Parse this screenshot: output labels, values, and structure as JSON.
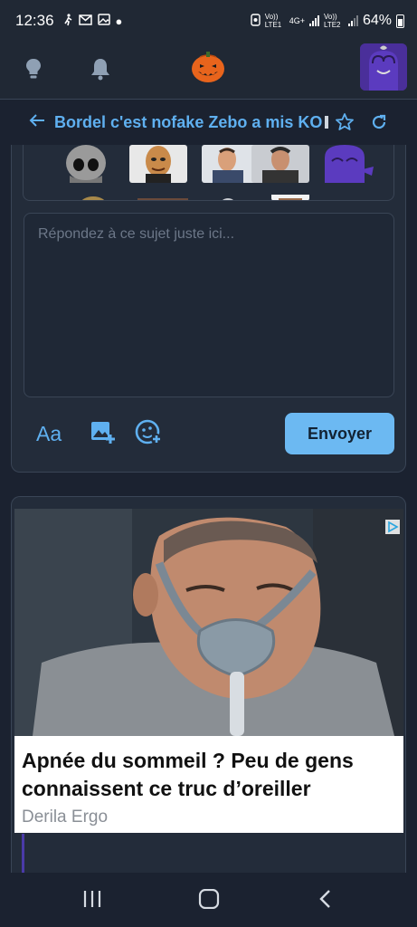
{
  "status_bar": {
    "time": "12:36",
    "sim1": "Vo)) LTE1",
    "network": "4G+",
    "sim2": "Vo)) LTE2",
    "battery": "64%"
  },
  "topic": {
    "title": "Bordel c'est nofake Zebo a mis KO"
  },
  "reply": {
    "placeholder": "Répondez à ce sujet juste ici...",
    "format_label": "Aa",
    "send_label": "Envoyer"
  },
  "ad": {
    "headline": "Apnée du sommeil ? Peu de gens connaissent ce truc d’oreiller",
    "source": "Derila Ergo"
  },
  "colors": {
    "background": "#1b2230",
    "accent": "#5fb0f0",
    "send_button": "#6cb9f2"
  },
  "icons": [
    "lightbulb-icon",
    "bell-icon",
    "pumpkin-logo",
    "back-arrow-icon",
    "star-icon",
    "refresh-icon",
    "image-add-icon",
    "sticker-add-icon",
    "adchoices-icon",
    "recent-apps-icon",
    "home-icon",
    "back-icon"
  ]
}
